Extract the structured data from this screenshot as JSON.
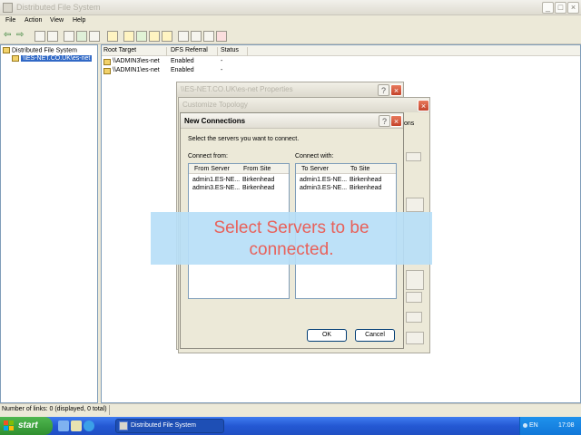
{
  "window": {
    "title": "Distributed File System"
  },
  "menu": [
    "File",
    "Action",
    "View",
    "Help"
  ],
  "tree": {
    "root": "Distributed File System",
    "child": "\\\\ES-NET.CO.UK\\es-net"
  },
  "list": {
    "columns": [
      "Root Target",
      "DFS Referral",
      "Status"
    ],
    "rows": [
      {
        "target": "\\\\ADMIN3\\es-net",
        "referral": "Enabled",
        "status": "-"
      },
      {
        "target": "\\\\ADMIN1\\es-net",
        "referral": "Enabled",
        "status": "-"
      }
    ]
  },
  "status_bar": {
    "text": "Number of links: 0 (displayed, 0 total)"
  },
  "properties_window": {
    "title": "\\\\ES-NET.CO.UK\\es-net Properties"
  },
  "topology_window": {
    "title": "Customize Topology",
    "fragment": "ons"
  },
  "dialog": {
    "title": "New Connections",
    "instruction": "Select the servers you want to connect.",
    "connect_from": {
      "label": "Connect from:",
      "columns": [
        "From Server",
        "From Site"
      ],
      "rows": [
        {
          "server": "admin1.ES-NE...",
          "site": "Birkenhead"
        },
        {
          "server": "admin3.ES-NE...",
          "site": "Birkenhead"
        }
      ]
    },
    "connect_with": {
      "label": "Connect with:",
      "columns": [
        "To Server",
        "To Site"
      ],
      "rows": [
        {
          "server": "admin1.ES-NE...",
          "site": "Birkenhead"
        },
        {
          "server": "admin3.ES-NE...",
          "site": "Birkenhead"
        }
      ]
    },
    "ok_label": "OK",
    "cancel_label": "Cancel",
    "help_label": "?",
    "close_label": "×"
  },
  "overlay": {
    "line1": "Select Servers to be",
    "line2": "connected."
  },
  "taskbar": {
    "start_label": "start",
    "task_label": "Distributed File System",
    "language": "EN",
    "clock": "17:08"
  },
  "colors": {
    "overlay_bg": "#b7def7",
    "overlay_text": "#e8615a",
    "taskbar": "#2458d3",
    "start_button": "#3a9a3a"
  }
}
